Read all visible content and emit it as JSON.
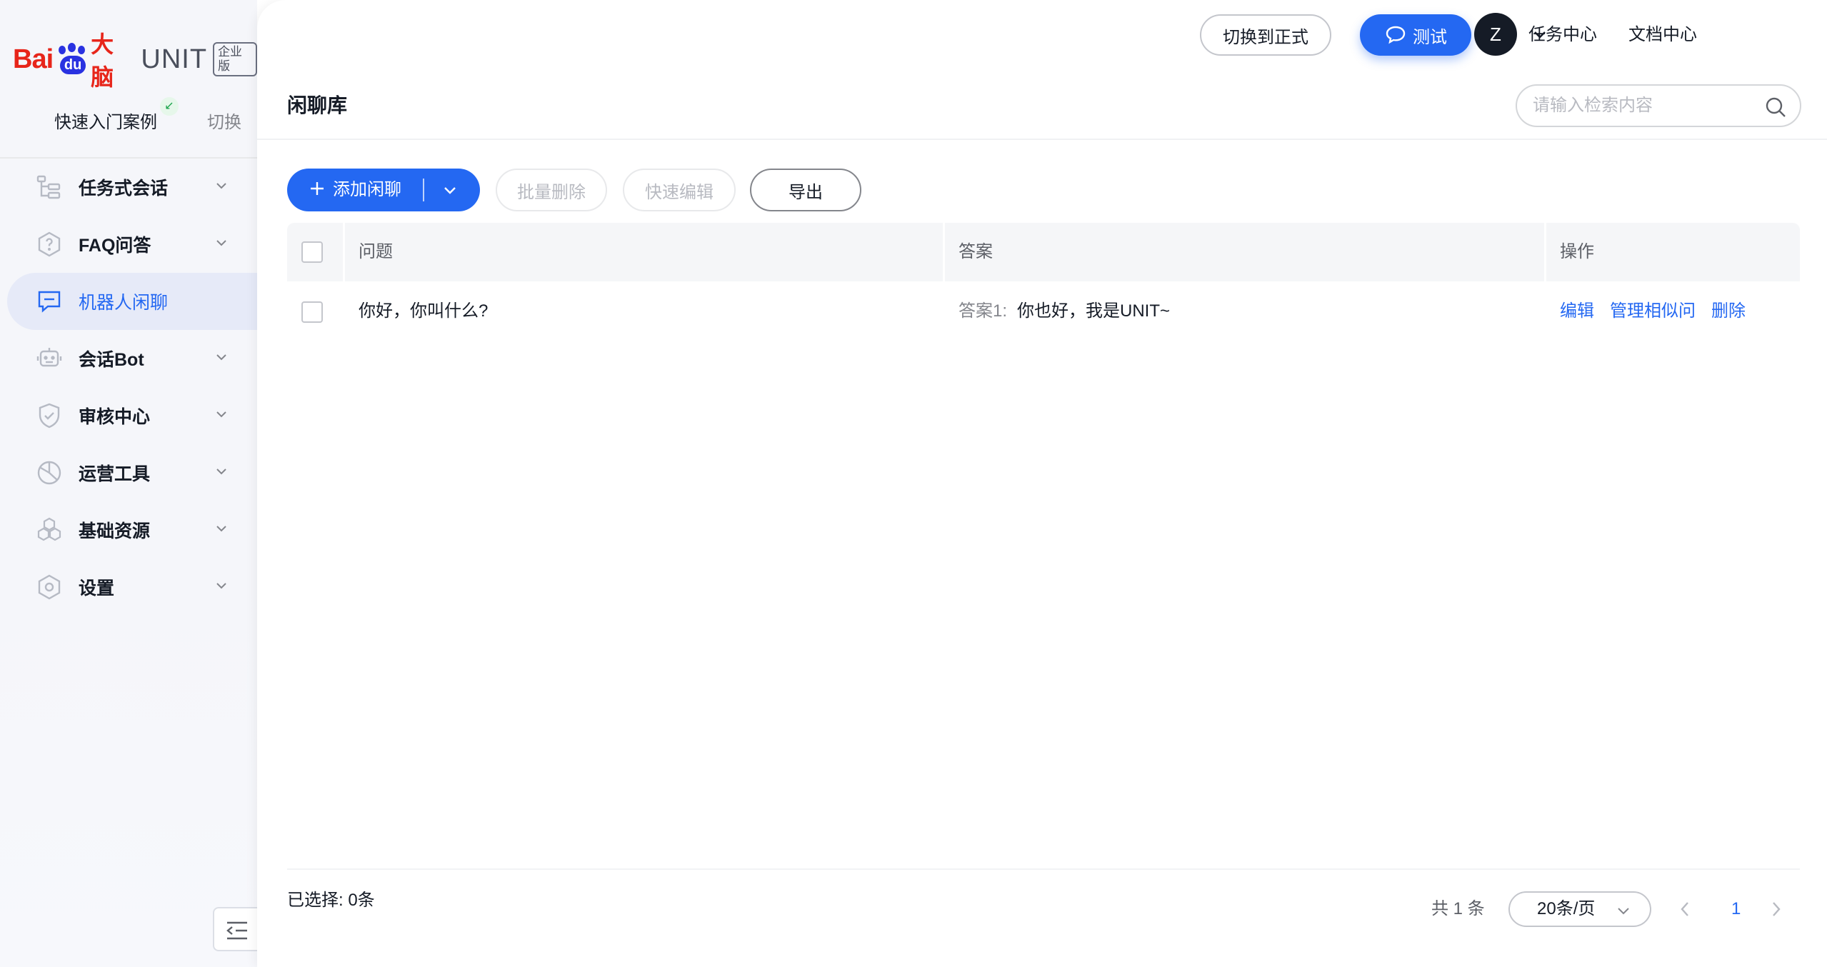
{
  "brand": {
    "logo_bai": "Bai",
    "logo_du": "du",
    "logo_danao": "大脑",
    "product": "UNIT",
    "edition": "企业版"
  },
  "project": {
    "name": "快速入门案例",
    "switch_label": "切换"
  },
  "sidebar": {
    "items": [
      {
        "label": "任务式会话",
        "icon": "task-flow-icon",
        "expandable": true,
        "active": false
      },
      {
        "label": "FAQ问答",
        "icon": "faq-icon",
        "expandable": true,
        "active": false
      },
      {
        "label": "机器人闲聊",
        "icon": "chat-bubble-icon",
        "expandable": false,
        "active": true
      },
      {
        "label": "会话Bot",
        "icon": "robot-icon",
        "expandable": true,
        "active": false
      },
      {
        "label": "审核中心",
        "icon": "shield-icon",
        "expandable": true,
        "active": false
      },
      {
        "label": "运营工具",
        "icon": "pie-chart-icon",
        "expandable": true,
        "active": false
      },
      {
        "label": "基础资源",
        "icon": "hexagons-icon",
        "expandable": true,
        "active": false
      },
      {
        "label": "设置",
        "icon": "settings-icon",
        "expandable": true,
        "active": false
      }
    ]
  },
  "topbar": {
    "switch_env_label": "切换到正式",
    "test_label": "测试",
    "task_center": "任务中心",
    "doc_center": "文档中心",
    "avatar_letter": "Z"
  },
  "page": {
    "title": "闲聊库",
    "search_placeholder": "请输入检索内容"
  },
  "toolbar": {
    "add_label": "添加闲聊",
    "batch_delete_label": "批量删除",
    "quick_edit_label": "快速编辑",
    "export_label": "导出"
  },
  "table": {
    "columns": [
      "问题",
      "答案",
      "操作"
    ],
    "rows": [
      {
        "question": "你好，你叫什么?",
        "answer_prefix": "答案1:",
        "answer": "你也好，我是UNIT~",
        "actions": [
          "编辑",
          "管理相似问",
          "删除"
        ]
      }
    ]
  },
  "footer": {
    "selected": "已选择: 0条",
    "total": "共 1 条",
    "page_size": "20条/页",
    "current_page": "1"
  },
  "colors": {
    "primary": "#2468f2",
    "brand_red": "#e7251a",
    "brand_blue": "#2932e1"
  }
}
